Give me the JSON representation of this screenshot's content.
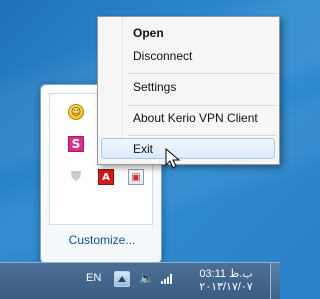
{
  "context_menu": {
    "items": [
      {
        "label": "Open"
      },
      {
        "label": "Disconnect"
      },
      {
        "label": "Settings"
      },
      {
        "label": "About Kerio VPN Client"
      },
      {
        "label": "Exit"
      }
    ]
  },
  "tray_overflow": {
    "icons": [
      "yahoo-messenger-icon",
      "s-app-icon",
      "shield-icon",
      "adobe-icon",
      "display-icon"
    ],
    "customize_label": "Customize..."
  },
  "taskbar": {
    "language": "EN",
    "time": "ب.ظ 03:11",
    "date": "۲۰۱۳/۱۷/۰۷"
  }
}
